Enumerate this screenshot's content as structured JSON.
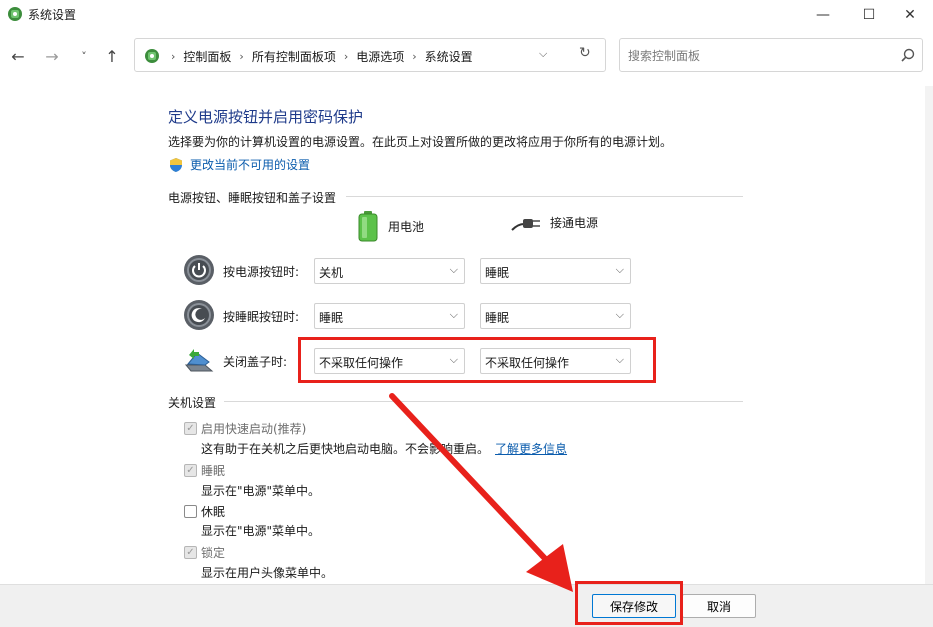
{
  "window": {
    "title": "系统设置",
    "minimize_glyph": "—",
    "maximize_glyph": "☐",
    "close_glyph": "✕"
  },
  "nav": {
    "back_glyph": "←",
    "forward_glyph": "→",
    "recent_glyph": "˅",
    "up_glyph": "↑",
    "breadcrumbs": [
      "控制面板",
      "所有控制面板项",
      "电源选项",
      "系统设置"
    ],
    "crumb_separator": "›",
    "dropdown_glyph": "⌵",
    "refresh_glyph": "↻",
    "search_placeholder": "搜索控制面板"
  },
  "page": {
    "title": "定义电源按钮并启用密码保护",
    "description": "选择要为你的计算机设置的电源设置。在此页上对设置所做的更改将应用于你所有的电源计划。",
    "change_link": "更改当前不可用的设置"
  },
  "power_section": {
    "heading": "电源按钮、睡眠按钮和盖子设置",
    "columns": {
      "battery": "用电池",
      "plugged": "接通电源"
    },
    "rows": [
      {
        "label": "按电源按钮时:",
        "battery": "关机",
        "plugged": "睡眠",
        "icon": "power-button-icon"
      },
      {
        "label": "按睡眠按钮时:",
        "battery": "睡眠",
        "plugged": "睡眠",
        "icon": "sleep-button-icon"
      },
      {
        "label": "关闭盖子时:",
        "battery": "不采取任何操作",
        "plugged": "不采取任何操作",
        "icon": "laptop-lid-icon"
      }
    ]
  },
  "shutdown_section": {
    "heading": "关机设置",
    "items": [
      {
        "label": "启用快速启动(推荐)",
        "desc": "这有助于在关机之后更快地启动电脑。不会影响重启。",
        "link": "了解更多信息",
        "checked": true,
        "enabled": false
      },
      {
        "label": "睡眠",
        "desc": "显示在\"电源\"菜单中。",
        "checked": true,
        "enabled": false
      },
      {
        "label": "休眠",
        "desc": "显示在\"电源\"菜单中。",
        "checked": false,
        "enabled": true
      },
      {
        "label": "锁定",
        "desc": "显示在用户头像菜单中。",
        "checked": true,
        "enabled": false
      }
    ]
  },
  "footer": {
    "save_label": "保存修改",
    "cancel_label": "取消"
  },
  "colors": {
    "title_blue": "#1e3a8a",
    "link_blue": "#0b5cad",
    "annotation_red": "#e8211b"
  }
}
